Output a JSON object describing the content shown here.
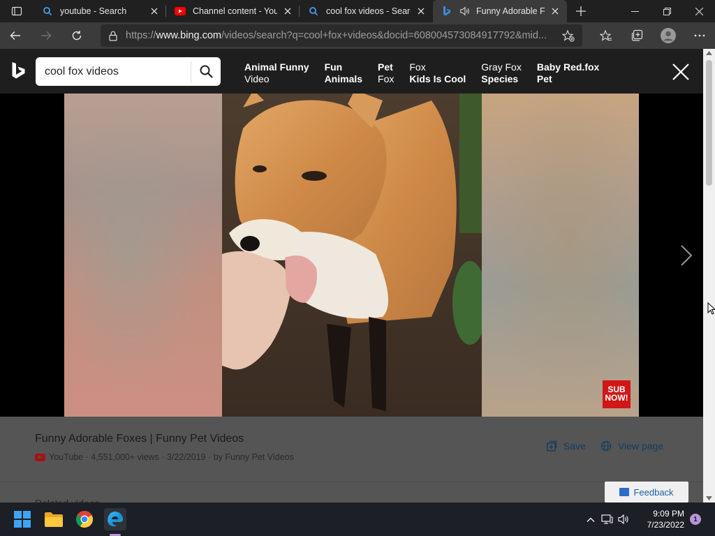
{
  "browser": {
    "tabs": [
      {
        "title": "youtube - Search",
        "icon": "search-icon"
      },
      {
        "title": "Channel content - YouTube",
        "icon": "youtube-icon"
      },
      {
        "title": "cool fox videos - Search",
        "icon": "search-icon"
      },
      {
        "title": "Funny Adorable Foxes",
        "icon": "bing-icon",
        "active": true,
        "audio": true
      }
    ],
    "address": {
      "prefix": "https://",
      "domain": "www.bing.com",
      "path": "/videos/search?q=cool+fox+videos&docid=608004573084917792&mid..."
    }
  },
  "bing": {
    "search_value": "cool fox videos",
    "related": [
      {
        "line1": "Animal Funny",
        "line2": "Video",
        "bold_line": 1
      },
      {
        "line1": "Fun",
        "line2": "Animals",
        "bold_line": "both"
      },
      {
        "line1": "Pet",
        "line2": "Fox",
        "bold_line": 1
      },
      {
        "line1": "Fox",
        "line2": "Kids Is Cool",
        "bold_line": 2
      },
      {
        "line1": "Gray Fox",
        "line2": "Species",
        "bold_line": 2
      },
      {
        "line1": "Baby Red.fox",
        "line2": "Pet",
        "bold_line": "both"
      }
    ]
  },
  "video": {
    "sub_badge": "SUB NOW!",
    "title": "Funny Adorable Foxes | Funny Pet Videos",
    "source": "YouTube",
    "meta": "· 4,551,000+ views · 3/22/2019 · by Funny Pet Videos",
    "save_label": "Save",
    "view_page_label": "View page",
    "related_heading": "Related videos"
  },
  "feedback_label": "Feedback",
  "taskbar": {
    "time": "9:09 PM",
    "date": "7/23/2022",
    "notification_count": "1"
  },
  "colors": {
    "accent": "#2b6cc8",
    "youtube_red": "#ff0000",
    "sub_badge": "#d01616"
  }
}
